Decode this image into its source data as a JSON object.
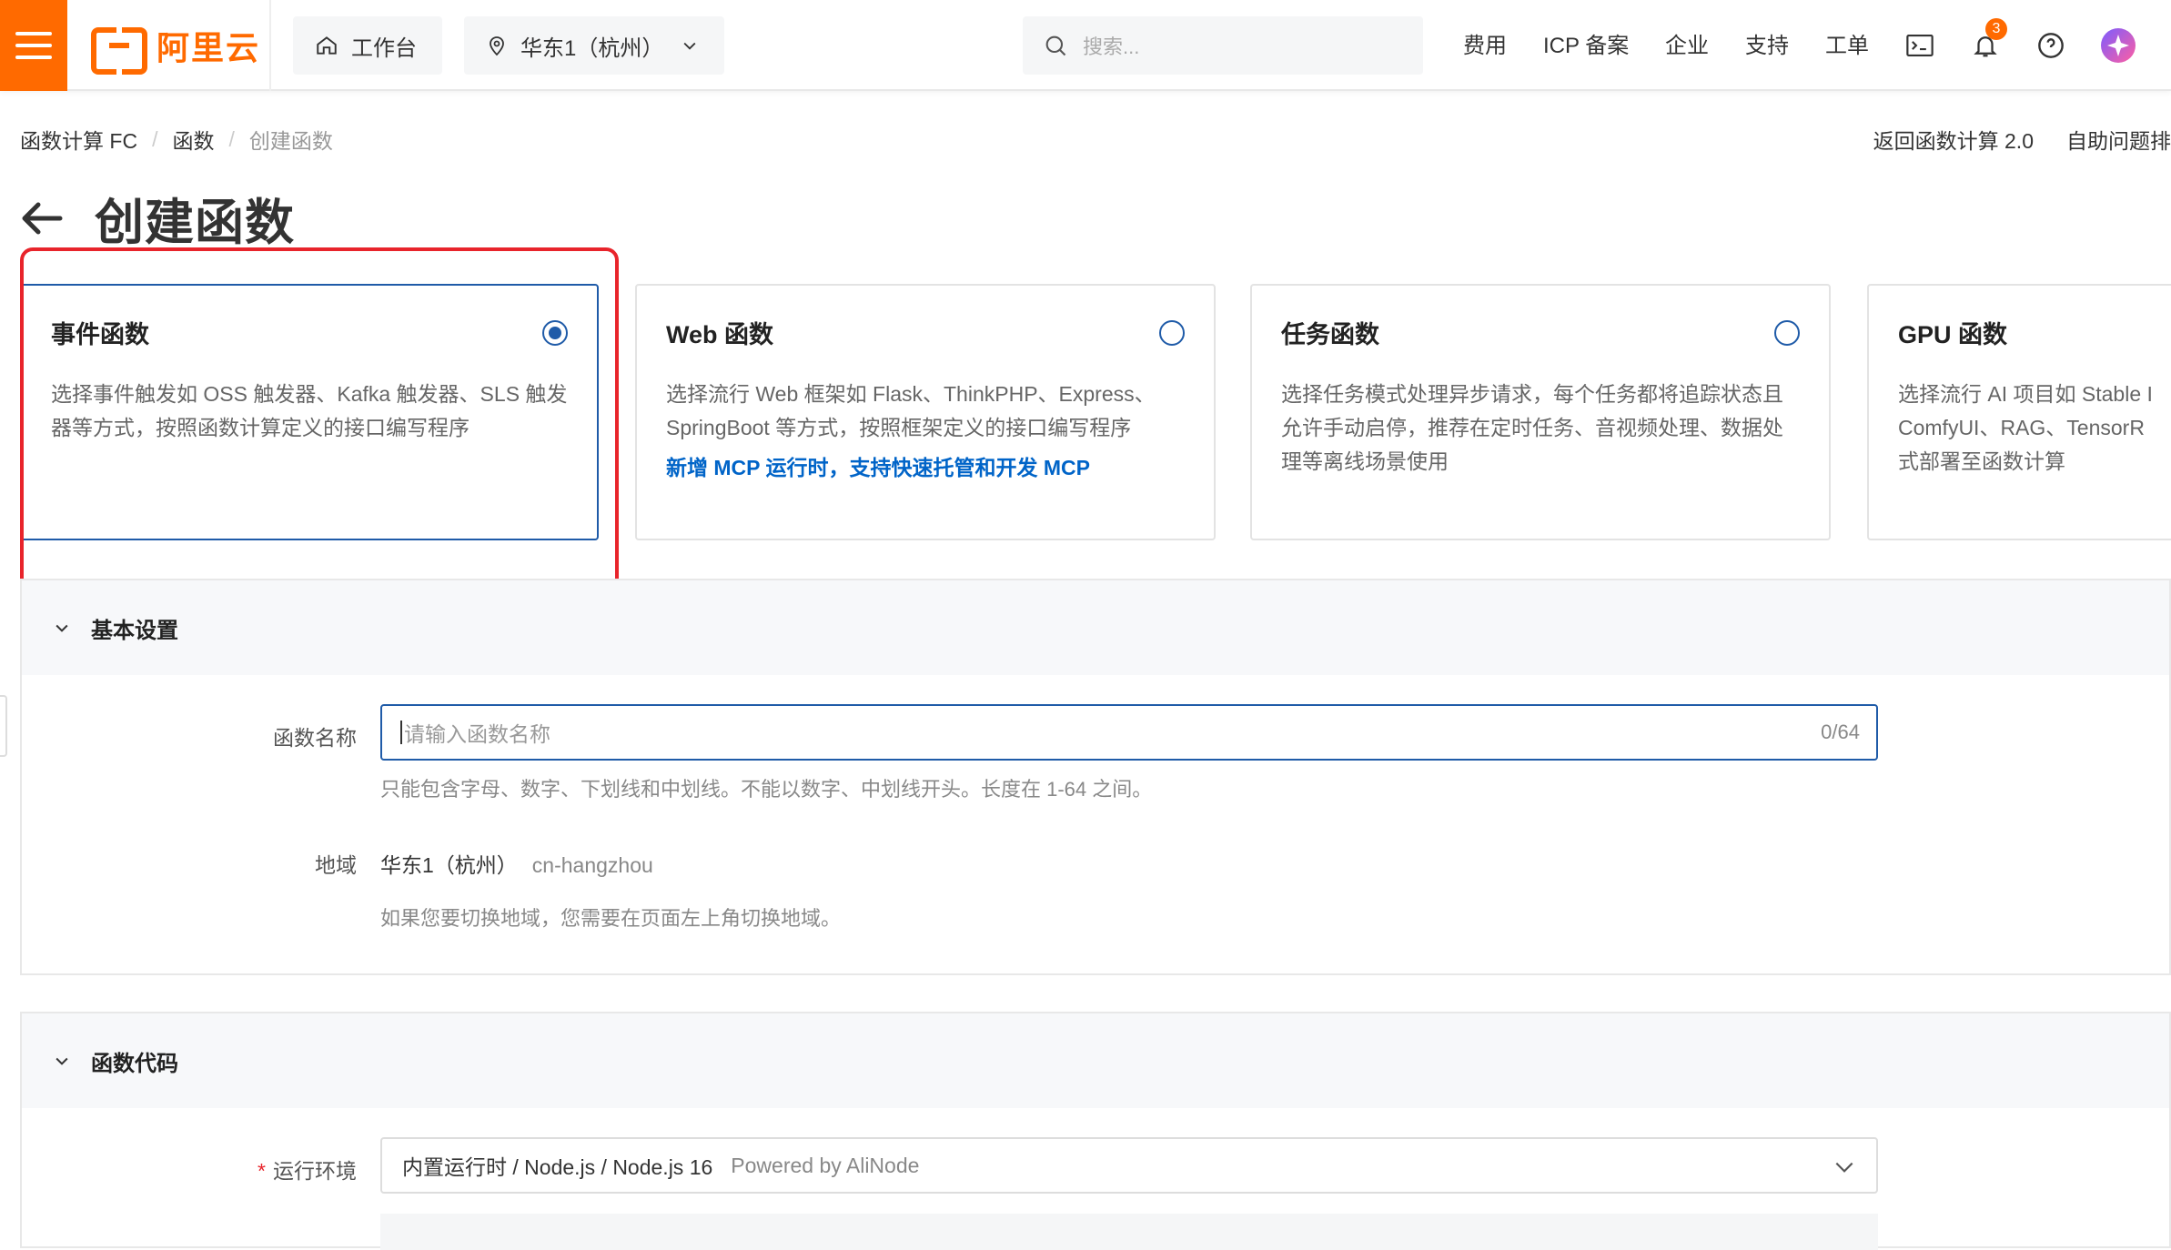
{
  "header": {
    "logo_text": "阿里云",
    "workbench": "工作台",
    "region": "华东1（杭州）",
    "search_placeholder": "搜索...",
    "nav": [
      "费用",
      "ICP 备案",
      "企业",
      "支持",
      "工单"
    ],
    "notification_count": "3"
  },
  "breadcrumb": [
    "函数计算 FC",
    "函数",
    "创建函数"
  ],
  "top_actions": [
    "返回函数计算 2.0",
    "自助问题排"
  ],
  "page_title": "创建函数",
  "cards": [
    {
      "title": "事件函数",
      "desc": "选择事件触发如 OSS 触发器、Kafka 触发器、SLS 触发器等方式，按照函数计算定义的接口编写程序",
      "link": "",
      "selected": true
    },
    {
      "title": "Web 函数",
      "desc": "选择流行 Web 框架如 Flask、ThinkPHP、Express、SpringBoot 等方式，按照框架定义的接口编写程序",
      "link": "新增 MCP 运行时，支持快速托管和开发 MCP",
      "selected": false
    },
    {
      "title": "任务函数",
      "desc": "选择任务模式处理异步请求，每个任务都将追踪状态且允许手动启停，推荐在定时任务、音视频处理、数据处理等离线场景使用",
      "link": "",
      "selected": false
    },
    {
      "title": "GPU 函数",
      "desc": "选择流行 AI 项目如 Stable I ComfyUI、RAG、TensorR 式部署至函数计算",
      "link": "",
      "selected": false
    }
  ],
  "basic": {
    "title": "基本设置",
    "name_label": "函数名称",
    "name_placeholder": "请输入函数名称",
    "name_counter": "0/64",
    "name_hint": "只能包含字母、数字、下划线和中划线。不能以数字、中划线开头。长度在 1-64 之间。",
    "region_label": "地域",
    "region_value": "华东1（杭州）",
    "region_code": "cn-hangzhou",
    "region_hint": "如果您要切换地域，您需要在页面左上角切换地域。"
  },
  "code": {
    "title": "函数代码",
    "runtime_label": "运行环境",
    "runtime_value": "内置运行时 / Node.js / Node.js 16",
    "runtime_sub": "Powered by AliNode"
  },
  "colors": {
    "brand": "#ff6a00",
    "primary": "#1f5ba8",
    "highlight": "#e8242b",
    "link": "#0064c8"
  }
}
